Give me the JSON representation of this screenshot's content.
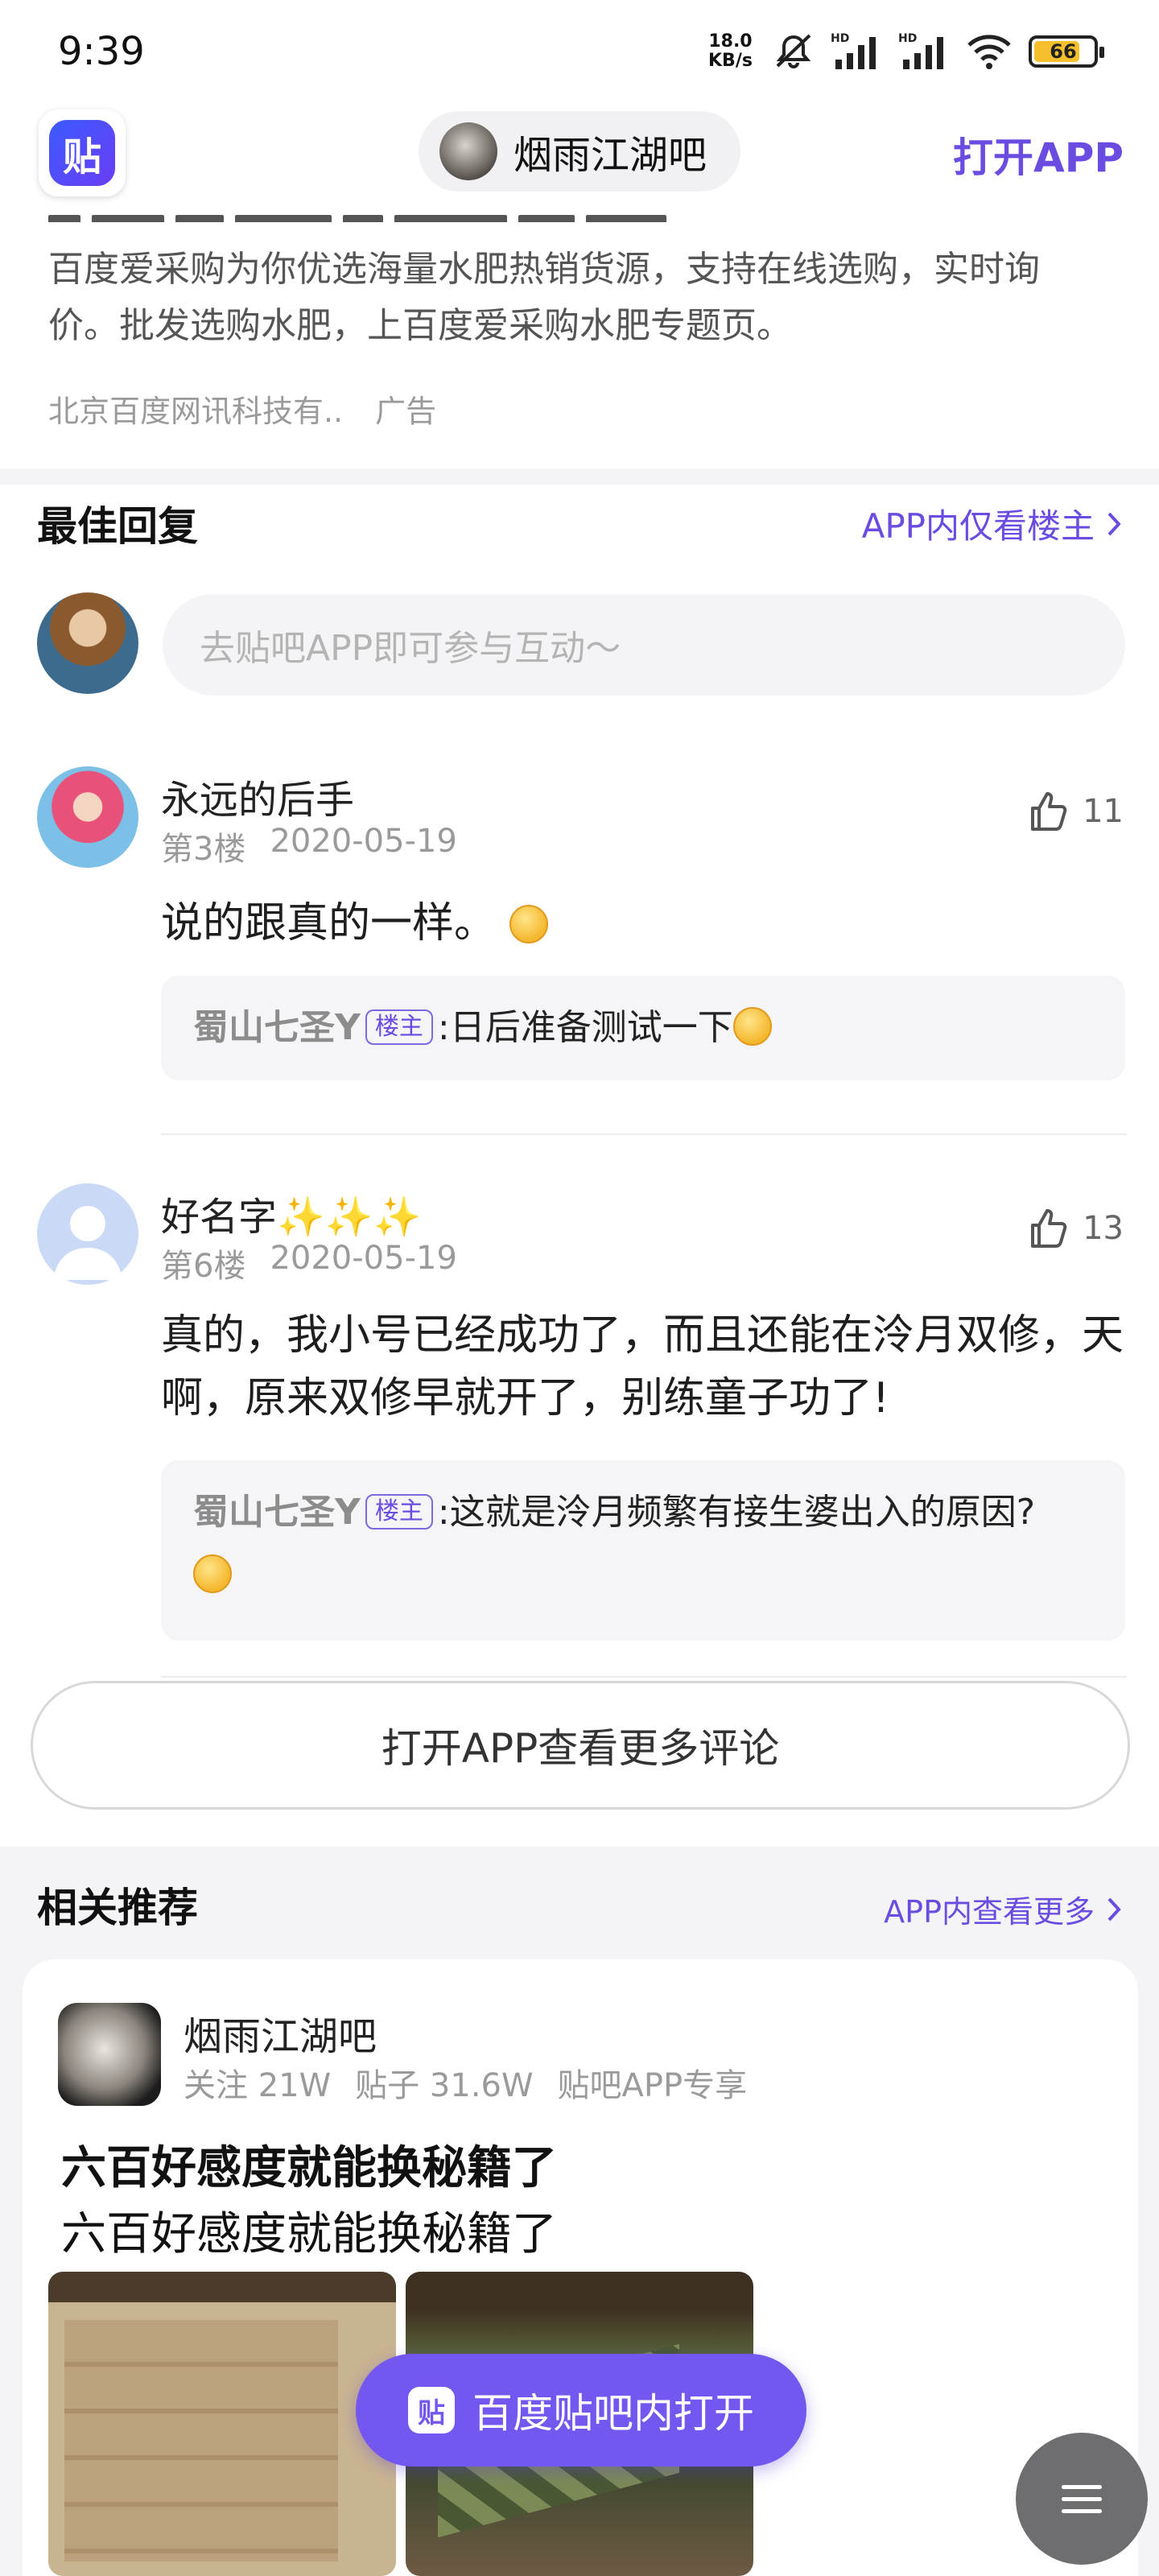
{
  "status_bar": {
    "time": "9:39",
    "speed_value": "18.0",
    "speed_unit": "KB/s",
    "battery": "66"
  },
  "top_nav": {
    "forum_name": "烟雨江湖吧",
    "open_app": "打开APP",
    "logo_char": "贴"
  },
  "ad": {
    "text": "百度爱采购为你优选海量水肥热销货源，支持在线选购，实时询价。批发选购水肥，上百度爱采购水肥专题页。",
    "advertiser": "北京百度网讯科技有..",
    "label": "广告"
  },
  "best_replies": {
    "title": "最佳回复",
    "link": "APP内仅看楼主",
    "input_placeholder": "去贴吧APP即可参与互动～"
  },
  "posts": [
    {
      "username": "永远的后手",
      "floor": "第3楼",
      "date": "2020-05-19",
      "likes": "11",
      "content": "说的跟真的一样。",
      "reply": {
        "author": "蜀山七圣Y",
        "badge": "楼主",
        "text": ":日后准备测试一下"
      }
    },
    {
      "username": "好名字✨✨✨",
      "floor": "第6楼",
      "date": "2020-05-19",
      "likes": "13",
      "content": "真的，我小号已经成功了，而且还能在泠月双修，天啊，原来双修早就开了，别练童子功了!",
      "reply": {
        "author": "蜀山七圣Y",
        "badge": "楼主",
        "text": ":这就是泠月频繁有接生婆出入的原因?"
      }
    }
  ],
  "more_comments": "打开APP查看更多评论",
  "related": {
    "title": "相关推荐",
    "link": "APP内查看更多",
    "card": {
      "forum_name": "烟雨江湖吧",
      "follows": "关注 21W",
      "posts": "贴子 31.6W",
      "tag": "贴吧APP专享",
      "title": "六百好感度就能换秘籍了",
      "subtitle": "六百好感度就能换秘籍了"
    }
  },
  "floating": {
    "open_in_tieba": "百度贴吧内打开",
    "icon_char": "贴"
  },
  "colors": {
    "accent": "#6b4ce0",
    "floating_button": "#7457ef"
  }
}
